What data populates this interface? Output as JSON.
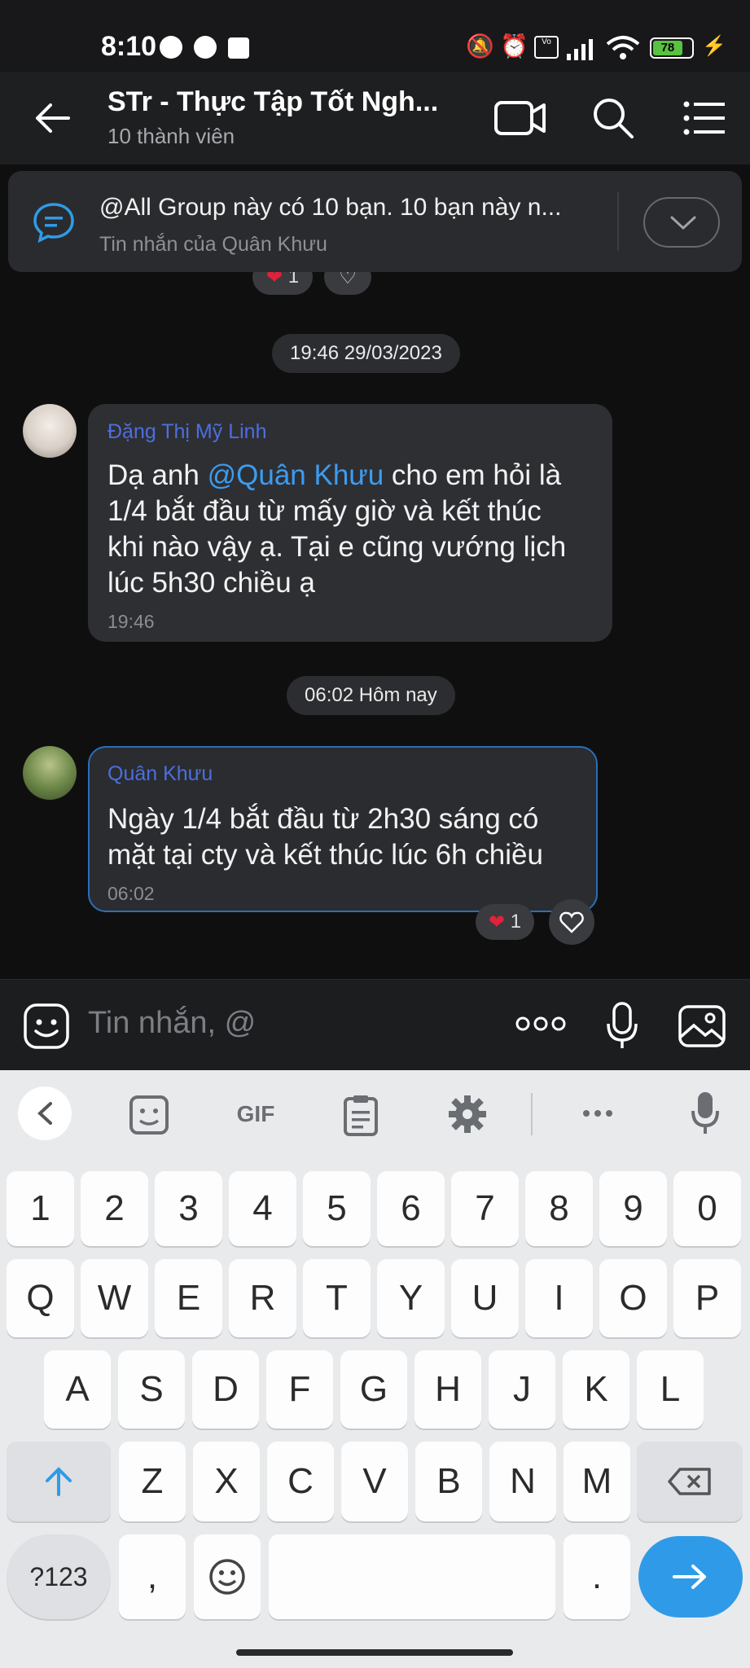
{
  "status_bar": {
    "time": "8:10",
    "battery": "78"
  },
  "header": {
    "title": "STr - Thực Tập Tốt Ngh...",
    "subtitle": "10 thành viên"
  },
  "pinned": {
    "text": "@All Group này có 10 bạn. 10 bạn này n...",
    "sub": "Tin nhắn của Quân Khưu"
  },
  "top_reaction": {
    "count": "1"
  },
  "messages": [
    {
      "time_chip": "19:46 29/03/2023",
      "sender": "Đặng Thị Mỹ Linh",
      "text_before": "Dạ anh ",
      "mention": "@Quân Khưu",
      "text_after_lines": [
        " cho em hỏi là",
        "1/4 bắt đầu từ mấy giờ và kết thúc",
        "khi nào vậy ạ. Tại e cũng vướng lịch",
        "lúc 5h30 chiều ạ"
      ],
      "time": "19:46"
    },
    {
      "time_chip": "06:02 Hôm nay",
      "sender": "Quân Khưu",
      "lines": [
        "Ngày 1/4 bắt đầu từ 2h30 sáng có",
        "mặt tại cty và kết thúc lúc 6h chiều"
      ],
      "time": "06:02",
      "reaction_count": "1"
    }
  ],
  "composer": {
    "placeholder": "Tin nhắn, @"
  },
  "keyboard": {
    "toolbar": {
      "gif": "GIF"
    },
    "row_numbers": [
      "1",
      "2",
      "3",
      "4",
      "5",
      "6",
      "7",
      "8",
      "9",
      "0"
    ],
    "row_q": [
      "Q",
      "W",
      "E",
      "R",
      "T",
      "Y",
      "U",
      "I",
      "O",
      "P"
    ],
    "row_a": [
      "A",
      "S",
      "D",
      "F",
      "G",
      "H",
      "J",
      "K",
      "L"
    ],
    "row_z": [
      "Z",
      "X",
      "C",
      "V",
      "B",
      "N",
      "M"
    ],
    "symbols": "?123",
    "comma": ",",
    "period": "."
  },
  "colors": {
    "accent": "#2f9be8",
    "mention": "#3c9cf0",
    "sender": "#4b6fe0"
  }
}
